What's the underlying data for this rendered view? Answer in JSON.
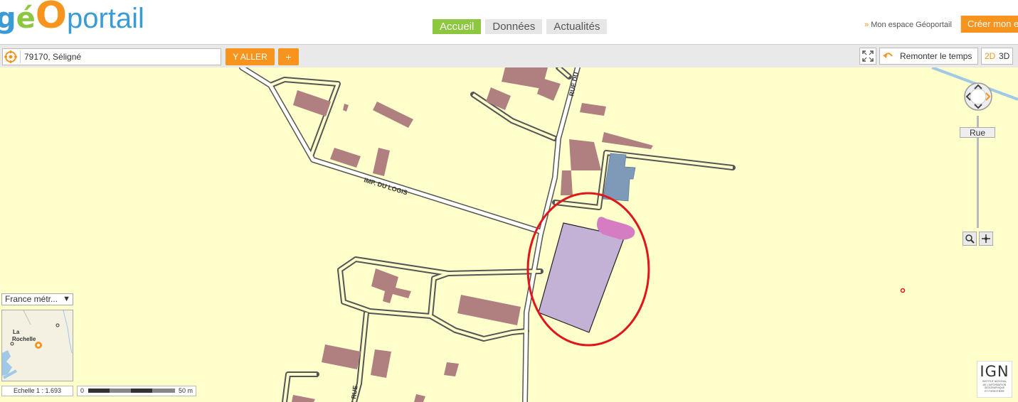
{
  "header": {
    "logo": {
      "g": "g",
      "e": "é",
      "o": "O",
      "portail": "portail"
    },
    "nav_tabs": [
      {
        "label": "Accueil",
        "active": true
      },
      {
        "label": "Données",
        "active": false
      },
      {
        "label": "Actualités",
        "active": false
      }
    ],
    "account_prefix": "»",
    "account_link": "Mon espace Géoportail",
    "create_button": "Créer mon e"
  },
  "toolbar": {
    "search_value": "79170, Séligné",
    "go_label": "Y ALLER",
    "plus_label": "+",
    "time_label": "Remonter le temps",
    "view_2d": "2D",
    "view_3d": "3D"
  },
  "map": {
    "street_labels": [
      "IMP. DU LOGIS",
      "RUE DU",
      "RUE"
    ],
    "zoom_level_label": "Rue",
    "region_select": "France métr...",
    "overview_labels": [
      "La",
      "Rochelle"
    ],
    "scale_label": "Echelle 1 :  1.693",
    "scale_zero": "0",
    "scale_max": "50 m",
    "ign_logo": "IGN",
    "ign_subtitle": "INSTITUT NATIONAL\nDE L'INFORMATION\nGÉOGRAPHIQUE\nET FORESTIÈRE"
  },
  "colors": {
    "accent": "#f7941d",
    "nav_active": "#8dc63f",
    "map_background": "#ffffcc",
    "building": "#b08080",
    "parcel_fill": "#c3b1d6",
    "highlight_circle": "#e0161c"
  }
}
